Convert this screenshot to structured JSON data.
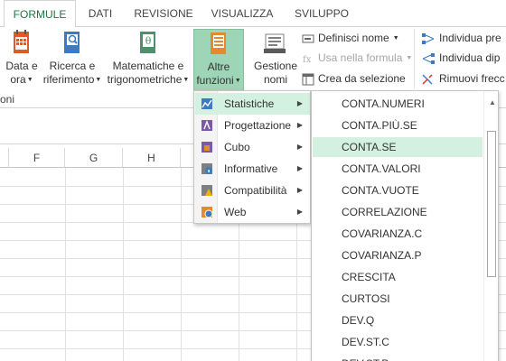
{
  "tabs": [
    {
      "label": "FORMULE",
      "active": true
    },
    {
      "label": "DATI"
    },
    {
      "label": "REVISIONE"
    },
    {
      "label": "VISUALIZZA"
    },
    {
      "label": "SVILUPPO"
    }
  ],
  "ribbon": {
    "data_ora": {
      "line1": "Data e",
      "line2": "ora",
      "icon": "calendar-icon"
    },
    "ricerca": {
      "line1": "Ricerca e",
      "line2": "riferimento",
      "icon": "magnifier-book-icon"
    },
    "matematiche": {
      "line1": "Matematiche e",
      "line2": "trigonometriche",
      "icon": "theta-book-icon"
    },
    "altre": {
      "line1": "Altre",
      "line2": "funzioni",
      "icon": "more-functions-book-icon"
    },
    "gestione": {
      "line1": "Gestione",
      "line2": "nomi",
      "icon": "name-manager-icon"
    },
    "definisci_nome": "Definisci nome",
    "usa_formula": "Usa nella formula",
    "crea_selezione": "Crea da selezione",
    "individua_prec": "Individua pre",
    "individua_dip": "Individua dip",
    "rimuovi_frecce": "Rimuovi frecc",
    "group_label": "oni"
  },
  "columns": [
    "F",
    "G",
    "H"
  ],
  "more_functions_menu": [
    {
      "label": "Statistiche",
      "icon": "statistics-icon",
      "highlighted": true
    },
    {
      "label": "Progettazione",
      "icon": "engineering-icon"
    },
    {
      "label": "Cubo",
      "icon": "cube-icon"
    },
    {
      "label": "Informative",
      "icon": "information-icon"
    },
    {
      "label": "Compatibilità",
      "icon": "compatibility-warning-icon"
    },
    {
      "label": "Web",
      "icon": "web-icon"
    }
  ],
  "statistics_functions": [
    {
      "label": "CONTA.NUMERI"
    },
    {
      "label": "CONTA.PIÙ.SE"
    },
    {
      "label": "CONTA.SE",
      "highlighted": true
    },
    {
      "label": "CONTA.VALORI"
    },
    {
      "label": "CONTA.VUOTE"
    },
    {
      "label": "CORRELAZIONE"
    },
    {
      "label": "COVARIANZA.C"
    },
    {
      "label": "COVARIANZA.P"
    },
    {
      "label": "CRESCITA"
    },
    {
      "label": "CURTOSI"
    },
    {
      "label": "DEV.Q"
    },
    {
      "label": "DEV.ST.C"
    },
    {
      "label": "DEV.ST.P"
    }
  ],
  "colors": {
    "accent": "#217346",
    "highlight": "#d3f0e0",
    "ribbon_active": "#9fd5b7"
  }
}
